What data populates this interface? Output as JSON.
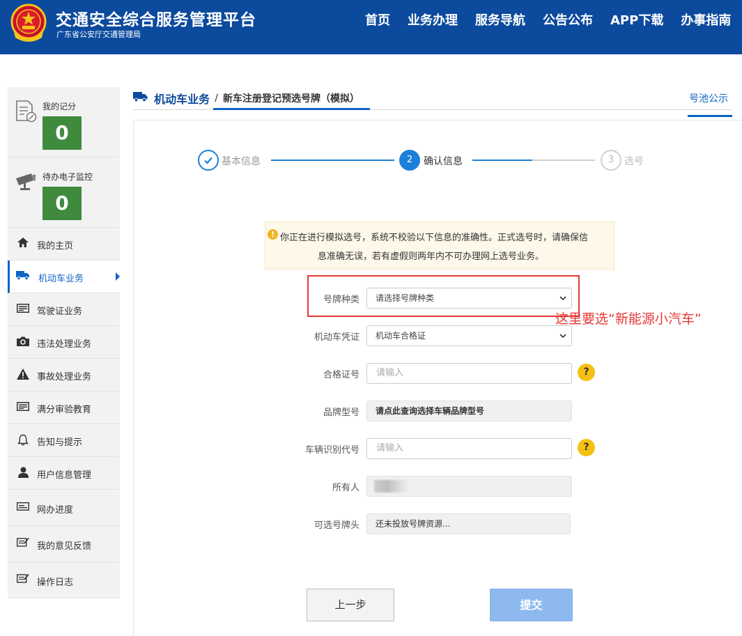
{
  "header": {
    "title": "交通安全综合服务管理平台",
    "subtitle": "广东省公安厅交通管理局",
    "nav": [
      "首页",
      "业务办理",
      "服务导航",
      "公告公布",
      "APP下载",
      "办事指南"
    ]
  },
  "sidebar": {
    "score": {
      "label": "我的记分",
      "value": "0"
    },
    "monitor": {
      "label": "待办电子监控",
      "value": "0"
    },
    "items": [
      {
        "label": "我的主页",
        "icon": "home-icon"
      },
      {
        "label": "机动车业务",
        "icon": "truck-icon",
        "active": true
      },
      {
        "label": "驾驶证业务",
        "icon": "card-icon"
      },
      {
        "label": "违法处理业务",
        "icon": "camera-icon"
      },
      {
        "label": "事故处理业务",
        "icon": "warning-icon"
      },
      {
        "label": "满分审验教育",
        "icon": "card-icon"
      },
      {
        "label": "告知与提示",
        "icon": "bell-icon"
      },
      {
        "label": "用户信息管理",
        "icon": "user-icon"
      },
      {
        "label": "网办进度",
        "icon": "progress-icon"
      },
      {
        "label": "我的意见反馈",
        "icon": "feedback-icon"
      },
      {
        "label": "操作日志",
        "icon": "log-icon"
      }
    ]
  },
  "breadcrumb": {
    "section": "机动车业务",
    "separator": "/",
    "page": "新车注册登记预选号牌（模拟）"
  },
  "pool_link": "号池公示",
  "steps": [
    {
      "num": "1",
      "label": "基本信息",
      "state": "done"
    },
    {
      "num": "2",
      "label": "确认信息",
      "state": "active"
    },
    {
      "num": "3",
      "label": "选号",
      "state": "pending"
    }
  ],
  "warning": {
    "icon": "!",
    "line1": "你正在进行模拟选号，系统不校验以下信息的准确性。正式选号时，请确保信",
    "line2": "息准确无误，若有虚假则两年内不可办理网上选号业务。"
  },
  "form": {
    "plate_type": {
      "label": "号牌种类",
      "value": "请选择号牌种类"
    },
    "vehicle_cert": {
      "label": "机动车凭证",
      "value": "机动车合格证"
    },
    "cert_no": {
      "label": "合格证号",
      "placeholder": "请输入",
      "help": "?"
    },
    "brand_model": {
      "label": "品牌型号",
      "value": "请点此查询选择车辆品牌型号"
    },
    "vin": {
      "label": "车辆识别代号",
      "placeholder": "请输入",
      "help": "?"
    },
    "owner": {
      "label": "所有人",
      "value": ""
    },
    "plate_prefix": {
      "label": "可选号牌头",
      "value": "还未投放号牌资源..."
    }
  },
  "annotation": "这里要选“新能源小汽车”",
  "buttons": {
    "prev": "上一步",
    "submit": "提交"
  },
  "colors": {
    "header_bg": "#0c4a9e",
    "accent": "#1d80d8",
    "score_green": "#3f8a3d",
    "annotation_red": "#e53935",
    "submit_disabled": "#8db9ee"
  }
}
